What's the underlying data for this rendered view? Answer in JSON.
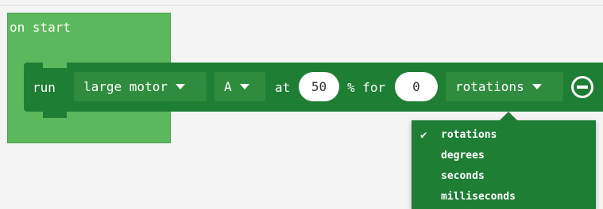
{
  "colors": {
    "event_block": "#5cb85c",
    "motor_block": "#1e7e34",
    "dropdown_field": "#2f8c3e",
    "text": "#ffffff"
  },
  "event_block": {
    "label": "on start"
  },
  "run_block": {
    "run_label": "run",
    "motor_type": "large motor",
    "port": "A",
    "at_label": "at",
    "speed_value": "50",
    "percent_for_label": "% for",
    "duration_value": "0",
    "unit": "rotations",
    "remove_icon": "minus-circle-icon"
  },
  "unit_menu": {
    "items": [
      {
        "label": "rotations",
        "selected": true
      },
      {
        "label": "degrees",
        "selected": false
      },
      {
        "label": "seconds",
        "selected": false
      },
      {
        "label": "milliseconds",
        "selected": false
      }
    ],
    "check_glyph": "✔"
  }
}
